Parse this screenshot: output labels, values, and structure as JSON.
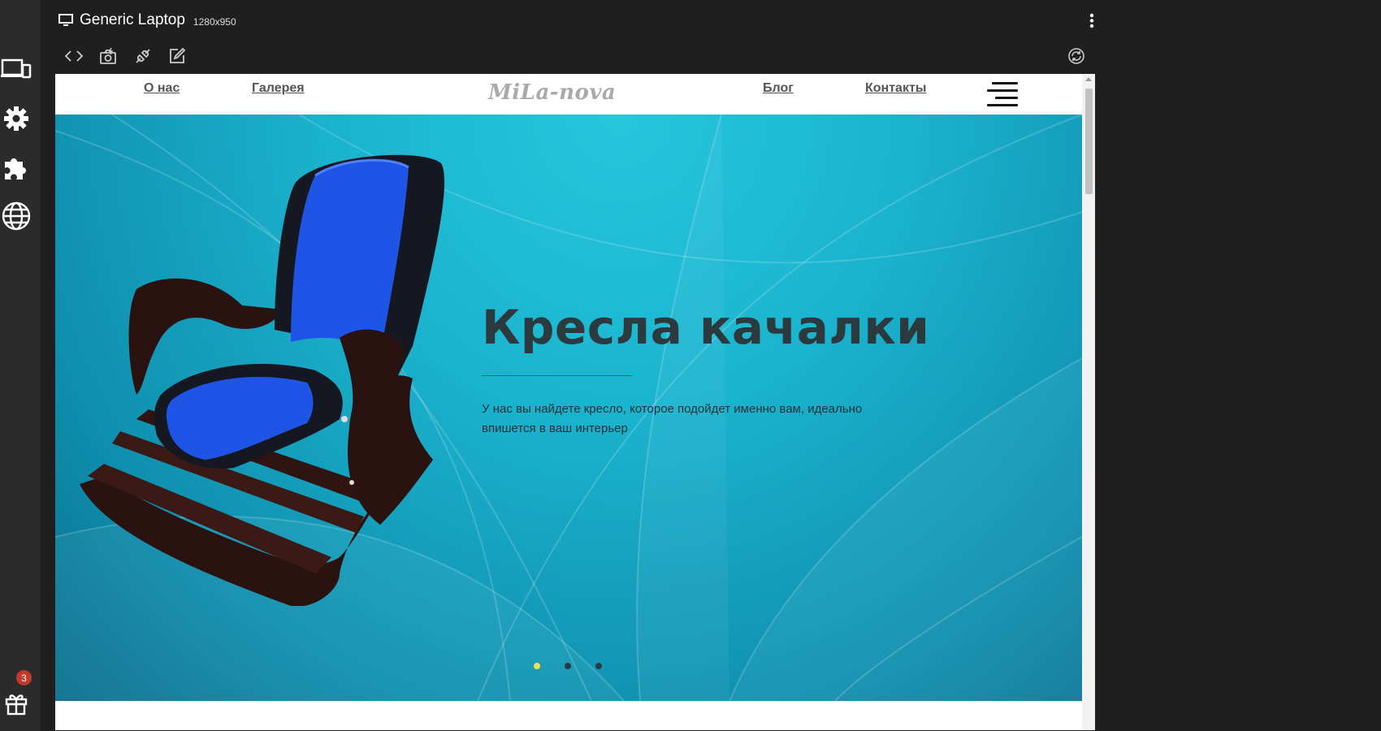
{
  "device": {
    "name": "Generic Laptop",
    "dimensions": "1280x950"
  },
  "rail": {
    "notification_count": "3"
  },
  "site": {
    "logo": "MiLa-nova",
    "nav": {
      "about": "О нас",
      "gallery": "Галерея",
      "blog": "Блог",
      "contacts": "Контакты"
    }
  },
  "hero": {
    "title": "Кресла качалки",
    "text": "У нас вы найдете кресло, которое подойдет именно вам, идеально впишется в ваш интерьер",
    "slides": {
      "count": 3,
      "active": 1
    }
  },
  "colors": {
    "accent_dot": "#f3e04a",
    "hero_bg": "#1bb4cf",
    "badge": "#c0392b"
  }
}
